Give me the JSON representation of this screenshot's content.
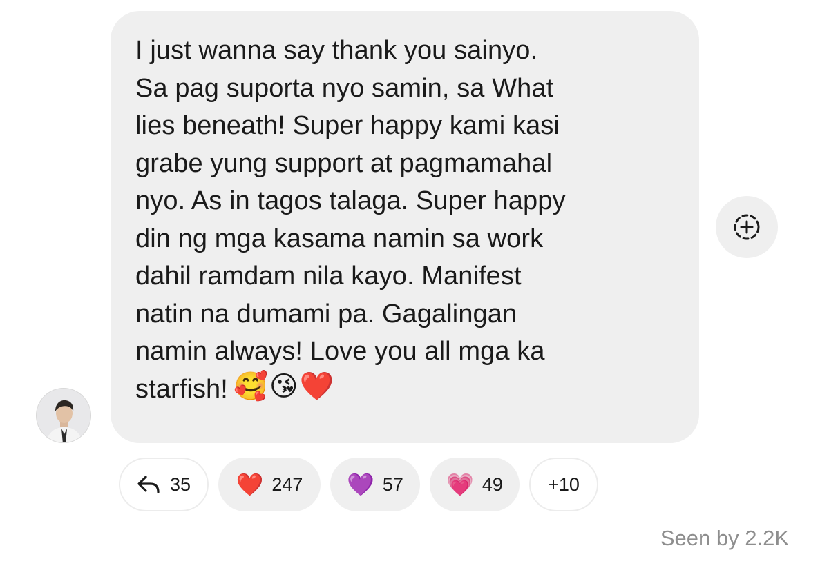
{
  "message": {
    "lines": [
      "I just wanna say thank you sainyo.",
      "Sa pag suporta nyo samin, sa What",
      "lies beneath! Super happy kami kasi",
      "grabe yung support at pagmamahal",
      "nyo. As in tagos talaga. Super happy",
      "din ng mga kasama namin sa work",
      "dahil ramdam nila kayo. Manifest",
      "natin na dumami pa. Gagalingan",
      "namin always! Love you all mga ka"
    ],
    "last_line": "starfish!",
    "emojis": [
      "🥰",
      "😘",
      "❤️"
    ]
  },
  "add_reaction_icon": "add-reaction-icon",
  "reactions": {
    "reply": {
      "icon": "reply-arrow-icon",
      "count": "35"
    },
    "heart": {
      "emoji": "❤️",
      "count": "247"
    },
    "purple_heart": {
      "emoji": "💜",
      "count": "57"
    },
    "growing_heart": {
      "emoji": "💗",
      "count": "49"
    },
    "more": {
      "label": "+10"
    }
  },
  "seen": "Seen by 2.2K",
  "colors": {
    "bubble": "#efefef",
    "text": "#1a1a1a",
    "muted": "#8e8e8e"
  }
}
